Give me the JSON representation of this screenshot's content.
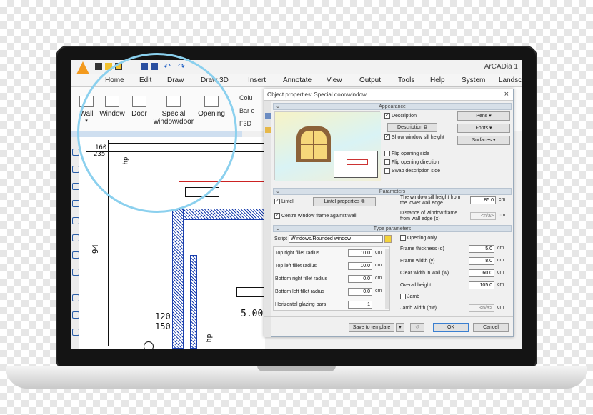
{
  "app": {
    "title": "ArCADia 1"
  },
  "menu": [
    "Home",
    "Edit",
    "Draw",
    "Draw 3D",
    "Insert",
    "Annotate",
    "View",
    "Output",
    "Tools",
    "Help",
    "System",
    "Landsc"
  ],
  "ribbon": {
    "buttons": [
      {
        "label": "Wall"
      },
      {
        "label": "Window"
      },
      {
        "label": "Door"
      },
      {
        "label": "Special window/door"
      },
      {
        "label": "Opening"
      }
    ],
    "side": [
      "Colu",
      "Bar e",
      "F3D"
    ]
  },
  "drawing": {
    "dims": [
      "160",
      "235",
      "94",
      "120",
      "150",
      "5.00",
      "hp",
      "hp"
    ]
  },
  "dialog": {
    "title": "Object properties: Special door/window",
    "close": "×",
    "sections": {
      "appearance": "Appearance",
      "parameters": "Parameters",
      "type_parameters": "Type parameters"
    },
    "appearance": {
      "description_check": "Description",
      "description_btn": "Description",
      "show_sill": "Show window sill height",
      "flip_side": "Flip opening side",
      "flip_direction": "Flip opening direction",
      "swap_desc": "Swap description side",
      "pens": "Pens",
      "fonts": "Fonts",
      "surfaces": "Surfaces"
    },
    "parameters": {
      "lintel_check": "Lintel",
      "lintel_btn": "Lintel properties",
      "centre_frame": "Centre window frame against wall",
      "sill_height_label": "The window sill height from the lower wall edge",
      "sill_height_val": "85.0",
      "distance_label": "Distance of window frame from wall edge (x)",
      "distance_val": "<n/a>",
      "unit": "cm"
    },
    "type_params": {
      "script_label": "Script",
      "script_val": "Windows/Rounded window",
      "left": [
        {
          "label": "Top right fillet radius",
          "value": "10.0",
          "unit": "cm"
        },
        {
          "label": "Top left fillet radius",
          "value": "10.0",
          "unit": "cm"
        },
        {
          "label": "Bottom right fillet radius",
          "value": "0.0",
          "unit": "cm"
        },
        {
          "label": "Bottom left fillet radius",
          "value": "0.0",
          "unit": "cm"
        },
        {
          "label": "Horizontal glazing bars",
          "value": "1",
          "unit": ""
        }
      ],
      "opening_only": "Opening only",
      "right": [
        {
          "label": "Frame thickness (d)",
          "value": "5.0",
          "unit": "cm"
        },
        {
          "label": "Frame width (y)",
          "value": "8.0",
          "unit": "cm"
        },
        {
          "label": "Clear width in wall (w)",
          "value": "60.0",
          "unit": "cm"
        },
        {
          "label": "Overall height",
          "value": "105.0",
          "unit": "cm"
        }
      ],
      "jamb": "Jamb",
      "jamb_width_label": "Jamb width (bw)",
      "jamb_width_val": "<n/a>"
    },
    "footer": {
      "template": "Save to template",
      "ok": "OK",
      "cancel": "Cancel"
    }
  },
  "colors": {
    "accent": "#8bd0ee",
    "wall": "#1a3fae",
    "ok_border": "#3b7fd0"
  }
}
